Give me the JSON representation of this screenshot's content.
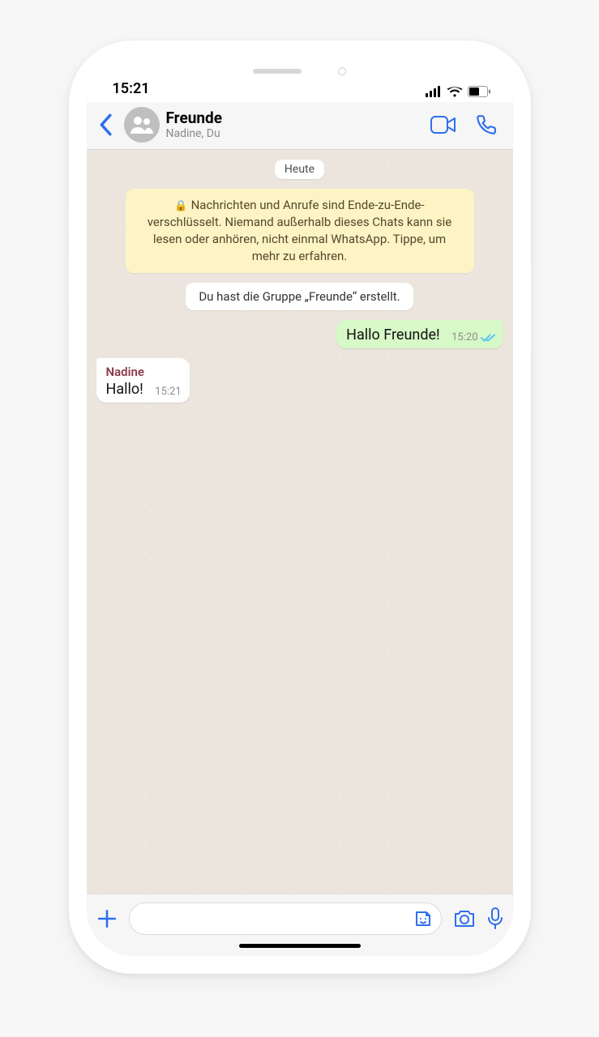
{
  "status": {
    "time": "15:21"
  },
  "header": {
    "title": "Freunde",
    "subtitle": "Nadine, Du"
  },
  "chat": {
    "date_label": "Heute",
    "encryption_notice": "Nachrichten und Anrufe sind Ende-zu-Ende-verschlüsselt. Niemand außerhalb dieses Chats kann sie lesen oder anhören, nicht einmal WhatsApp. Tippe, um mehr zu erfahren.",
    "system_message": "Du hast die Gruppe „Freunde“ erstellt.",
    "messages": [
      {
        "direction": "out",
        "sender": null,
        "text": "Hallo Freunde!",
        "time": "15:20",
        "status": "read"
      },
      {
        "direction": "in",
        "sender": "Nadine",
        "text": "Hallo!",
        "time": "15:21",
        "status": null
      }
    ]
  },
  "input": {
    "placeholder": ""
  }
}
